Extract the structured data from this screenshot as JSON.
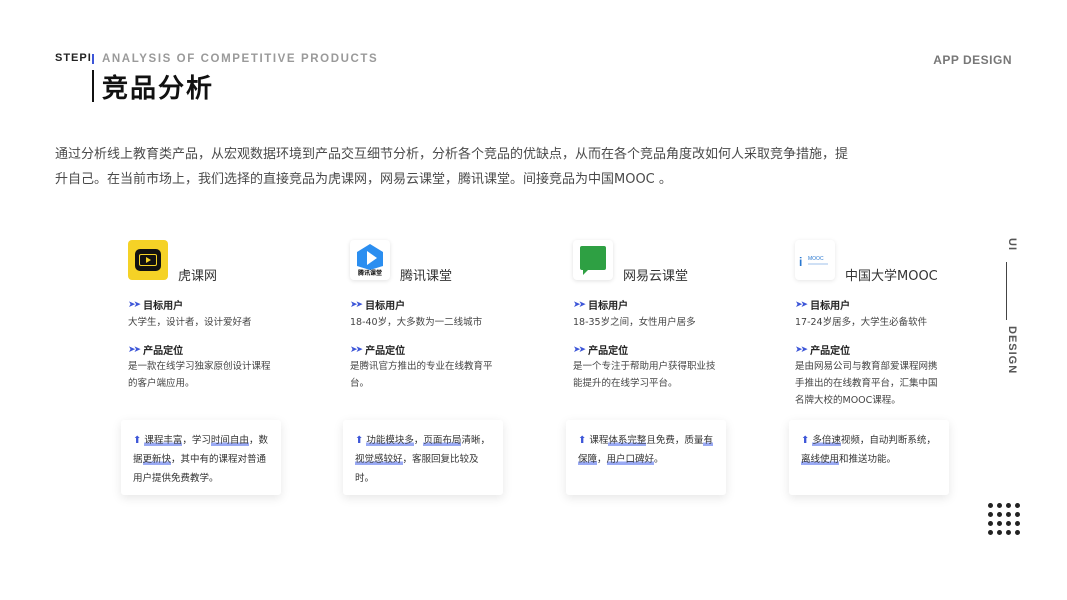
{
  "header": {
    "step": "STEPI",
    "subtitle_en": "ANALYSIS OF COMPETITIVE PRODUCTS",
    "title": "竞品分析",
    "right_label": "APP DESIGN"
  },
  "intro": {
    "line1": "通过分析线上教育类产品，从宏观数据环境到产品交互细节分析，分析各个竞品的优缺点，从而在各个竞品角度改如何人采取竞争措施，提",
    "line2": "升自己。在当前市场上，我们选择的直接竞品为虎课网，网易云课堂，腾讯课堂。间接竞品为中国MOOC 。"
  },
  "side": {
    "top": "UI",
    "bottom": "DESIGN"
  },
  "labels": {
    "target": "目标用户",
    "position": "产品定位"
  },
  "colors": {
    "accent": "#3d56d8",
    "highlight": "#4664eb"
  },
  "products": [
    {
      "name": "虎课网",
      "logo_icon": "huke-tv-logo",
      "target": "大学生，设计者，设计爱好者",
      "position": "是一款在线学习独家原创设计课程的客户端应用。",
      "summary": [
        {
          "t": "课程丰富",
          "h": true
        },
        {
          "t": "，学习",
          "h": false
        },
        {
          "t": "时间自由",
          "h": true
        },
        {
          "t": "，数据",
          "h": false
        },
        {
          "t": "更新快",
          "h": true
        },
        {
          "t": "，其中有的课程对普通用户提供免费教学。",
          "h": false
        }
      ]
    },
    {
      "name": "腾讯课堂",
      "logo_icon": "tengxun-play-logo",
      "logo_text": "腾讯课堂",
      "target": "18-40岁，大多数为一二线城市",
      "position": "是腾讯官方推出的专业在线教育平台。",
      "summary": [
        {
          "t": "功能模块多",
          "h": true
        },
        {
          "t": "，",
          "h": false
        },
        {
          "t": "页面布局",
          "h": true
        },
        {
          "t": "清晰，",
          "h": false
        },
        {
          "t": "视觉感较好",
          "h": true
        },
        {
          "t": "，客服回复比较及时。",
          "h": false
        }
      ]
    },
    {
      "name": "网易云课堂",
      "logo_icon": "wangyi-book-logo",
      "target": "18-35岁之间，女性用户居多",
      "position": "是一个专注于帮助用户获得职业技能提升的在线学习平台。",
      "summary": [
        {
          "t": "课程",
          "h": false
        },
        {
          "t": "体系完整",
          "h": true
        },
        {
          "t": "且免费，质量",
          "h": false
        },
        {
          "t": "有保障",
          "h": true
        },
        {
          "t": "，",
          "h": false
        },
        {
          "t": "用户口碑好",
          "h": true
        },
        {
          "t": "。",
          "h": false
        }
      ]
    },
    {
      "name": "中国大学MOOC",
      "logo_icon": "mooc-logo",
      "logo_text": "MOOC",
      "target": "17-24岁居多，大学生必备软件",
      "position": "是由网易公司与教育部爱课程网携手推出的在线教育平台，汇集中国名牌大校的MOOC课程。",
      "summary": [
        {
          "t": "多倍速",
          "h": true
        },
        {
          "t": "视频，自动判断系统，",
          "h": false
        },
        {
          "t": "离线使用",
          "h": true
        },
        {
          "t": "和推送功能。",
          "h": false
        }
      ]
    }
  ]
}
